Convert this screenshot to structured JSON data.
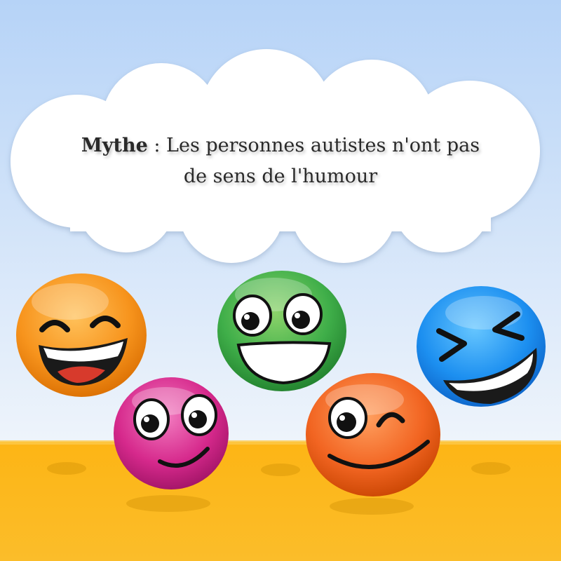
{
  "caption": {
    "emphasis": "Mythe",
    "separator": " : ",
    "line1": "Les personnes autistes n'ont pas",
    "line2": "de sens de l'humour"
  },
  "colors": {
    "sky_top": "#b6d3f7",
    "sky_bottom": "#eef4fb",
    "cloud": "#ffffff",
    "ground": "#fbb116",
    "smiley_orange": "#f7941d",
    "smiley_green": "#3fae49",
    "smiley_blue": "#1c8ff0",
    "smiley_pink": "#d6298c",
    "smiley_red_orange": "#f26522"
  },
  "smileys": [
    {
      "name": "orange-laughing-smiley",
      "expression": "laughing"
    },
    {
      "name": "green-grinning-smiley",
      "expression": "grinning"
    },
    {
      "name": "blue-squinting-smiley",
      "expression": "squinting-laugh"
    },
    {
      "name": "pink-smiling-smiley",
      "expression": "smiling"
    },
    {
      "name": "red-orange-winking-smiley",
      "expression": "winking"
    }
  ]
}
